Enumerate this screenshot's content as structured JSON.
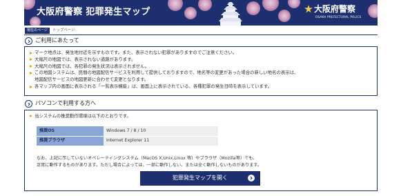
{
  "header": {
    "title": "大阪府警察 犯罪発生マップ",
    "brand_main": "大阪府警察",
    "brand_sub": "OSAKA PREFECTURAL POLICE"
  },
  "breadcrumb": {
    "current_label": "現在のページ",
    "page": "トップページ"
  },
  "notice": {
    "heading": "ご利用にあたって",
    "items": [
      {
        "text": "マーク地点は、発生地付近を示すものです。また、表示されない犯罪がありますのでご注意ください。",
        "bullet": true
      },
      {
        "text": "大縮尺の地図では、表示されない道路があります。",
        "bullet": true
      },
      {
        "text": "大縮尺の地図では、各犯罪の発生状況は表示されません。",
        "bullet": true
      },
      {
        "text": "この地図システムは、民間の地図配信サービスを利用して提供しておりますので、地名等の変更があった場合の新しい地名の表示は、",
        "bullet": true
      },
      {
        "text": "地図配信サービスの地図更新に合わせて変更となります。",
        "bullet": false
      },
      {
        "text": "各マップ内の画面に表示される「一覧表示機能」は、画面上に表示されている、各種犯罪の発生日時を表示しています。",
        "bullet": true
      }
    ]
  },
  "pc": {
    "heading": "パソコンで利用する方へ",
    "lead": "当システムの推奨動作環境は以下のとおりです。",
    "env": [
      {
        "key": "推奨OS",
        "value": "Windows 7 / 8 / 10"
      },
      {
        "key": "推奨ブラウザ",
        "value": "Internet Explorer 11"
      }
    ],
    "note_line1": "なお、上記に示していないオペレーティングシステム（MacOS X,Unix,Linux 等）やブラウザ（Mozilla等）でも、",
    "note_line2": "正常に動作するものがあります。ただし場合によっては、一部に動作しない、または全く動作しないものがあります。",
    "button_label": "犯罪発生マップを開く"
  },
  "colors": {
    "navy": "#1d2f6e",
    "bullet_orange": "#e69a10",
    "table_key_blue": "#8aa6d6"
  }
}
